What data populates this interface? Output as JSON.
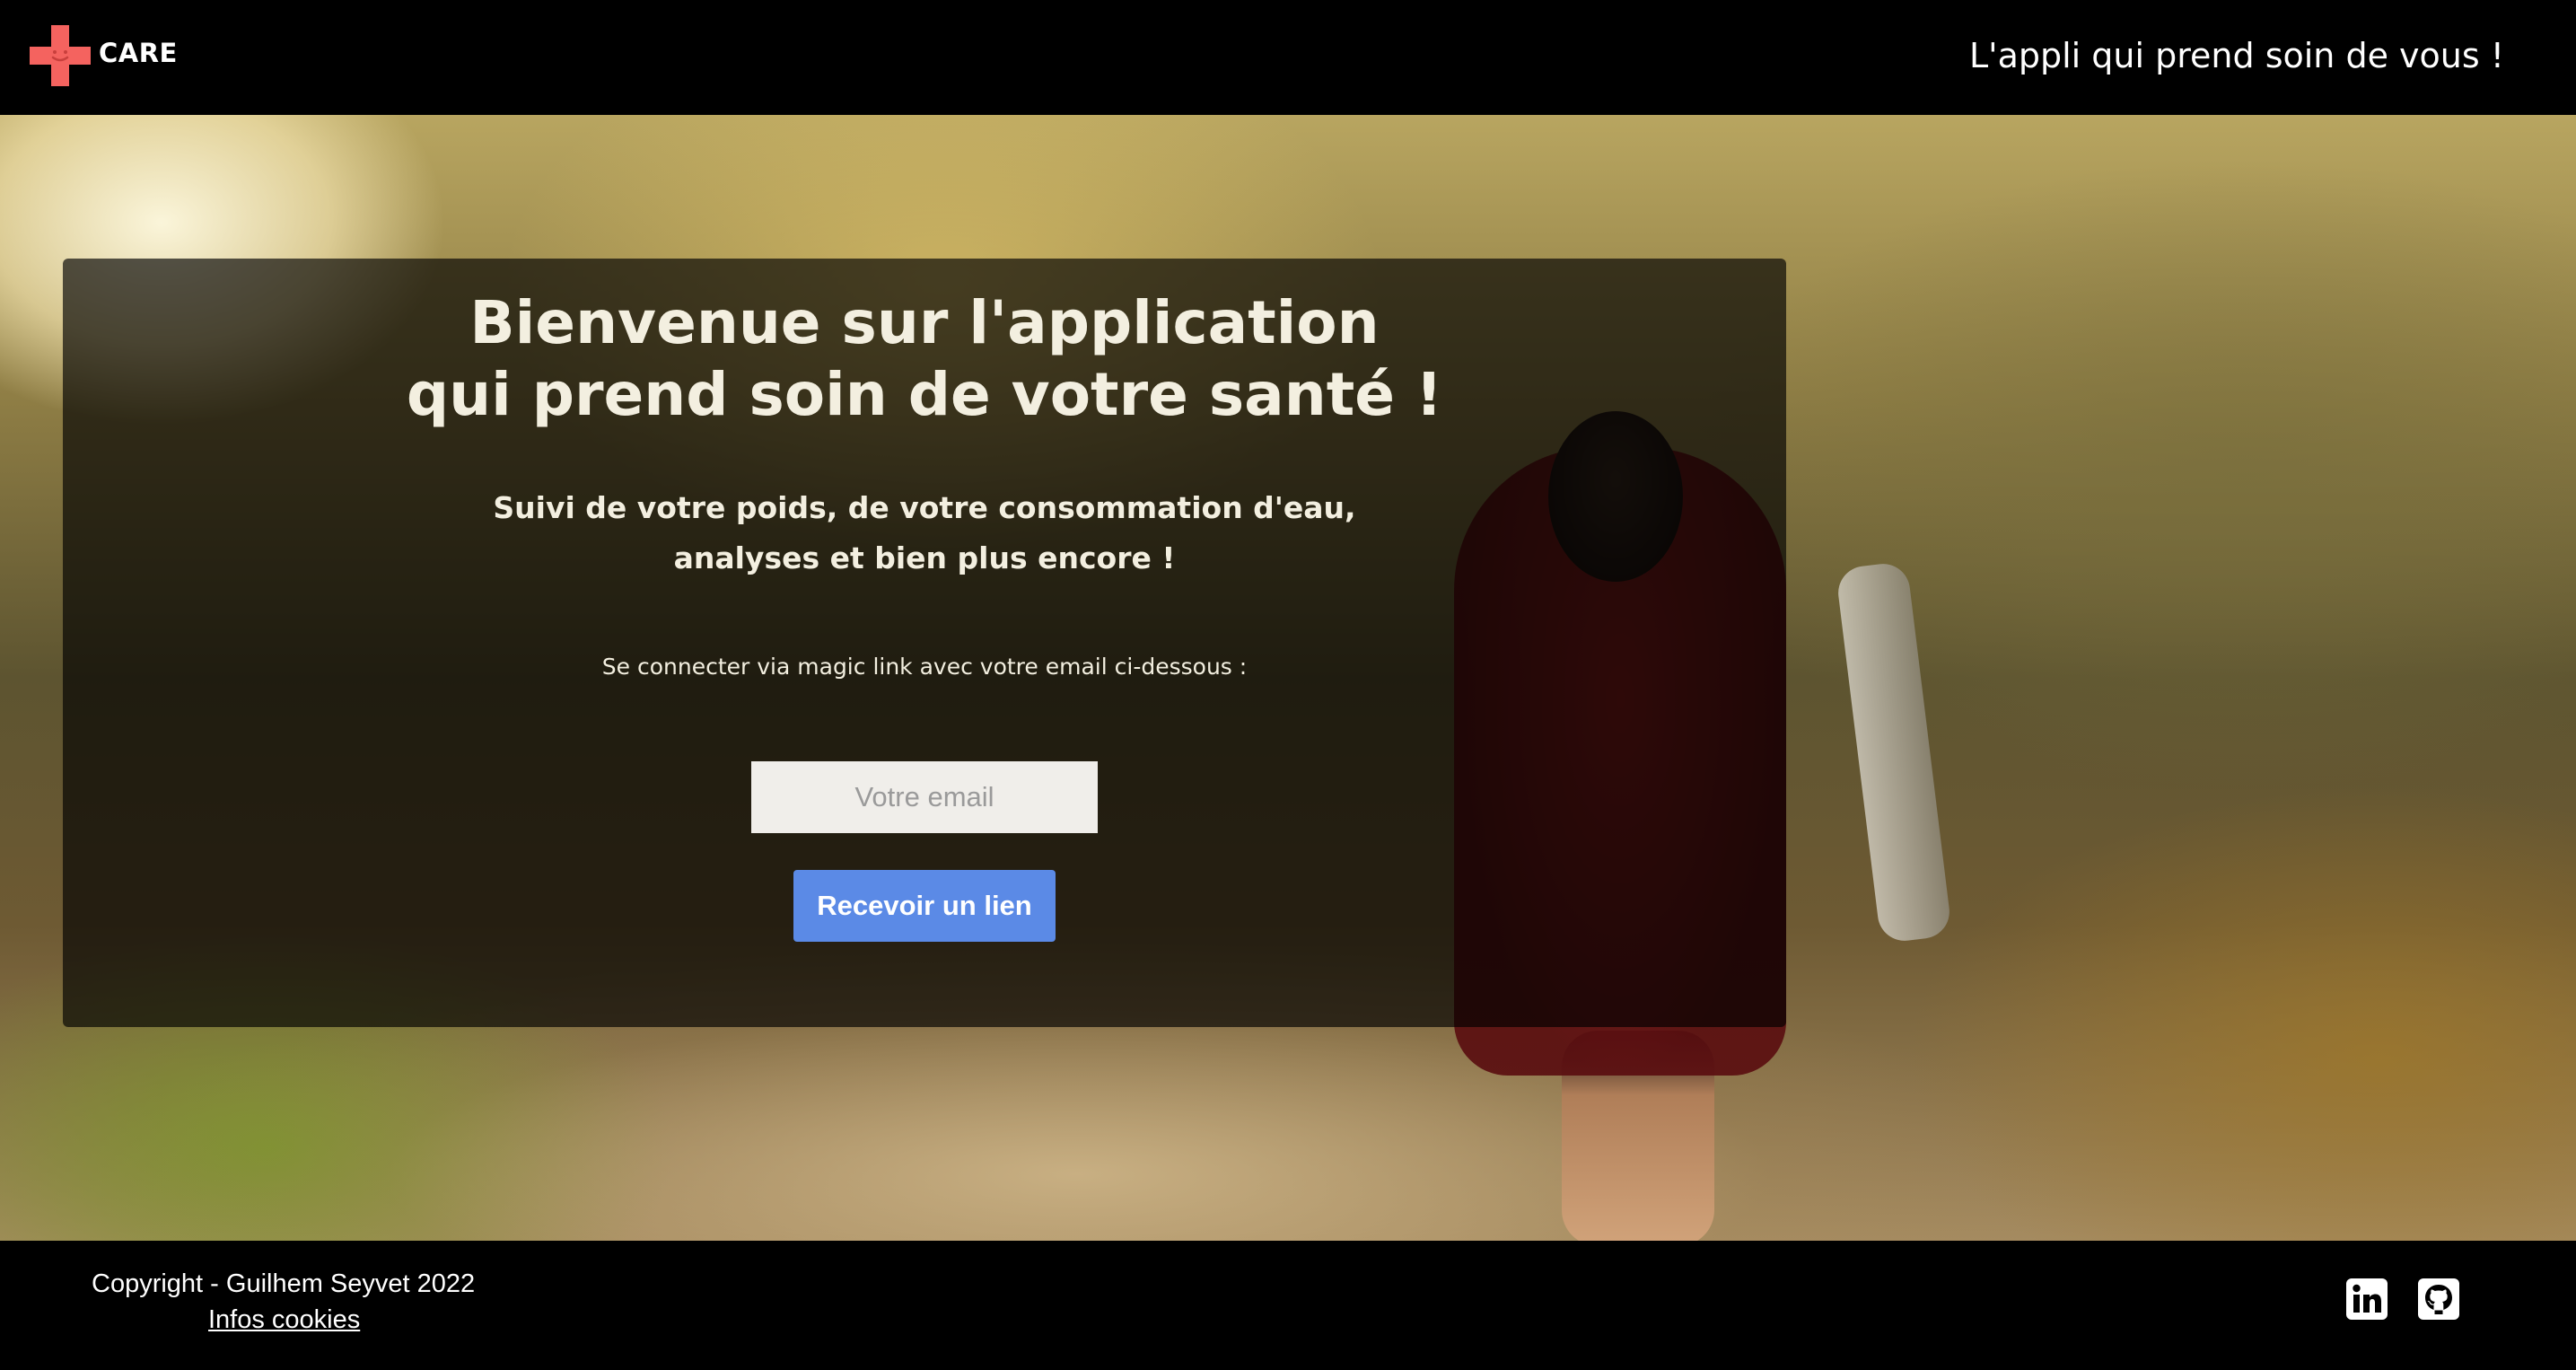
{
  "header": {
    "logo_text": "CARE",
    "tagline": "L'appli qui prend soin de vous !"
  },
  "card": {
    "title_line1": "Bienvenue sur l'application",
    "title_line2": "qui prend soin de votre santé !",
    "subtitle_line1": "Suivi de votre poids, de votre consommation d'eau,",
    "subtitle_line2": "analyses et bien plus encore !",
    "instruction": "Se connecter via magic link avec votre email ci-dessous :",
    "email_placeholder": "Votre email",
    "email_value": "",
    "submit_label": "Recevoir un lien"
  },
  "footer": {
    "copyright": "Copyright - Guilhem Seyvet 2022",
    "cookies_link": "Infos cookies",
    "social": [
      {
        "icon": "linkedin-icon"
      },
      {
        "icon": "github-icon"
      }
    ]
  },
  "colors": {
    "logo_cross": "#f4635f",
    "button": "#5b8ae6",
    "header_bg": "#000000",
    "footer_bg": "#000000",
    "card_overlay": "rgba(0,0,0,0.66)"
  }
}
